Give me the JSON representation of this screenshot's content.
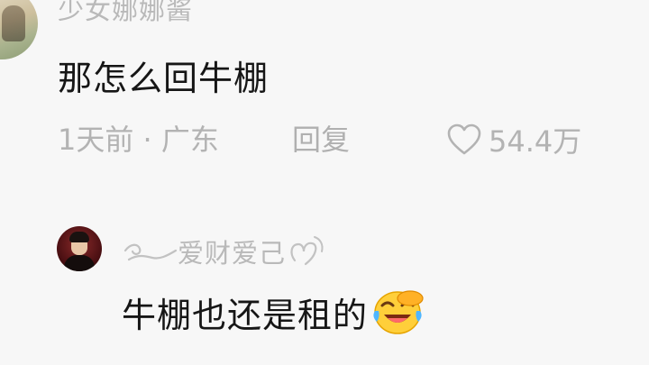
{
  "comment_top": {
    "username": "少女娜娜酱",
    "text": "那怎么回牛棚",
    "meta": "1天前 · 广东",
    "reply_label": "回复",
    "likes": "54.4万"
  },
  "reply_comment": {
    "username": "爱财爱己",
    "text": "牛棚也还是租的"
  },
  "icons": {
    "like": "heart-outline-icon",
    "emoji": "laughing-crying-emoji"
  },
  "colors": {
    "background": "#f7f7f7",
    "primary_text": "#161616",
    "secondary_text": "#b3b3b3"
  }
}
